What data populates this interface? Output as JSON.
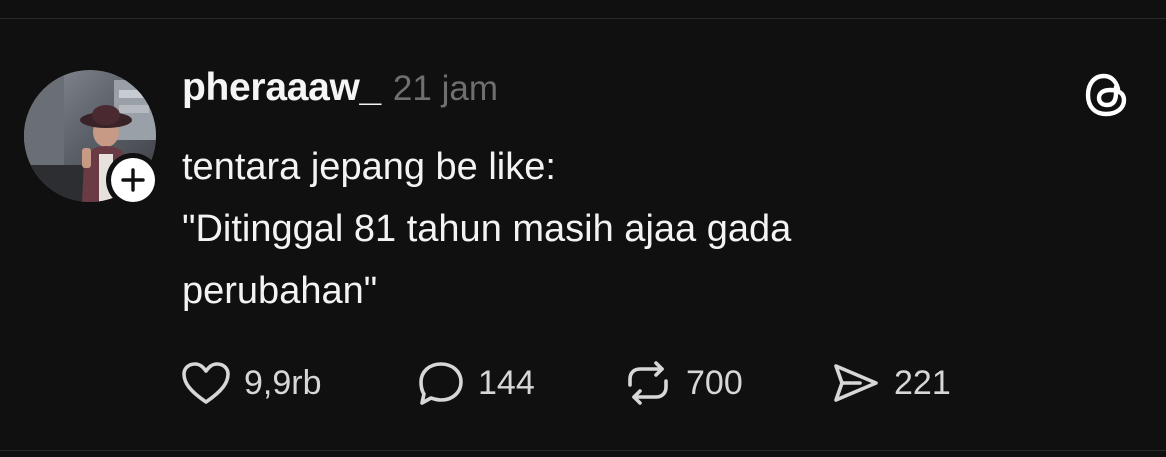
{
  "post": {
    "username": "pheraaaw_",
    "timestamp": "21 jam",
    "lines": [
      "tentara jepang be like:",
      "\"Ditinggal 81 tahun masih ajaa gada",
      "perubahan\""
    ],
    "stats": {
      "likes": "9,9rb",
      "replies": "144",
      "reposts": "700",
      "shares": "221"
    }
  },
  "icons": {
    "logo": "threads-logo-icon",
    "follow": "plus-icon",
    "like": "heart-icon",
    "reply": "comment-bubble-icon",
    "repost": "repost-arrows-icon",
    "share": "send-icon"
  },
  "colors": {
    "background": "#101010",
    "text": "#f3f3f3",
    "muted": "#6f6f6f",
    "icon": "#d7d7d7"
  }
}
